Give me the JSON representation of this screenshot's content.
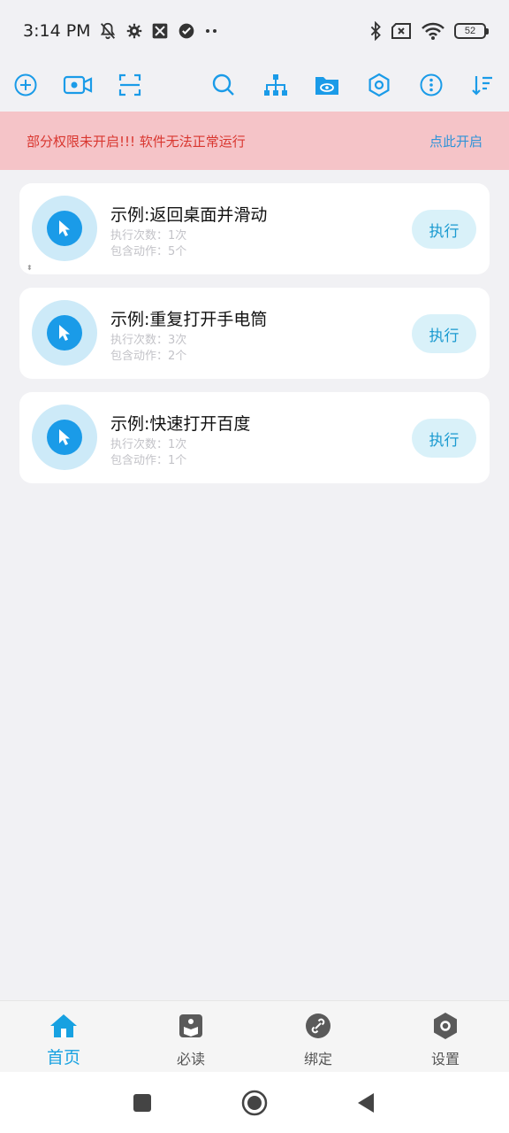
{
  "status_bar": {
    "time": "3:14 PM",
    "left_icons": [
      "mute-icon",
      "gear-icon",
      "app-icon",
      "check-circle-icon",
      "more-dots-icon"
    ],
    "right_icons": [
      "bluetooth-icon",
      "no-sim-icon",
      "wifi-icon"
    ],
    "battery": "52"
  },
  "toolbar": {
    "icons": [
      "add-circle-icon",
      "video-camera-icon",
      "scan-icon",
      "search-icon",
      "hierarchy-icon",
      "folder-eye-icon",
      "hexagon-settings-icon",
      "more-vertical-icon",
      "sort-icon"
    ],
    "accent_color": "#1a9be8"
  },
  "banner": {
    "message": "部分权限未开启!!! 软件无法正常运行",
    "action_label": "点此开启",
    "background": "#f5c4c8",
    "text_color": "#d9362f"
  },
  "scripts": [
    {
      "title": "示例:返回桌面并滑动",
      "run_count": "执行次数：1次",
      "action_count": "包含动作：5个",
      "button_label": "执行"
    },
    {
      "title": "示例:重复打开手电筒",
      "run_count": "执行次数：3次",
      "action_count": "包含动作：2个",
      "button_label": "执行"
    },
    {
      "title": "示例:快速打开百度",
      "run_count": "执行次数：1次",
      "action_count": "包含动作：1个",
      "button_label": "执行"
    }
  ],
  "bottom_nav": {
    "items": [
      {
        "label": "首页",
        "icon": "home-icon",
        "active": true
      },
      {
        "label": "必读",
        "icon": "book-icon",
        "active": false
      },
      {
        "label": "绑定",
        "icon": "link-icon",
        "active": false
      },
      {
        "label": "设置",
        "icon": "settings-hexagon-icon",
        "active": false
      }
    ],
    "active_color": "#17a1e1"
  },
  "system_nav": {
    "buttons": [
      "recent-apps-icon",
      "home-circle-icon",
      "back-icon"
    ]
  }
}
